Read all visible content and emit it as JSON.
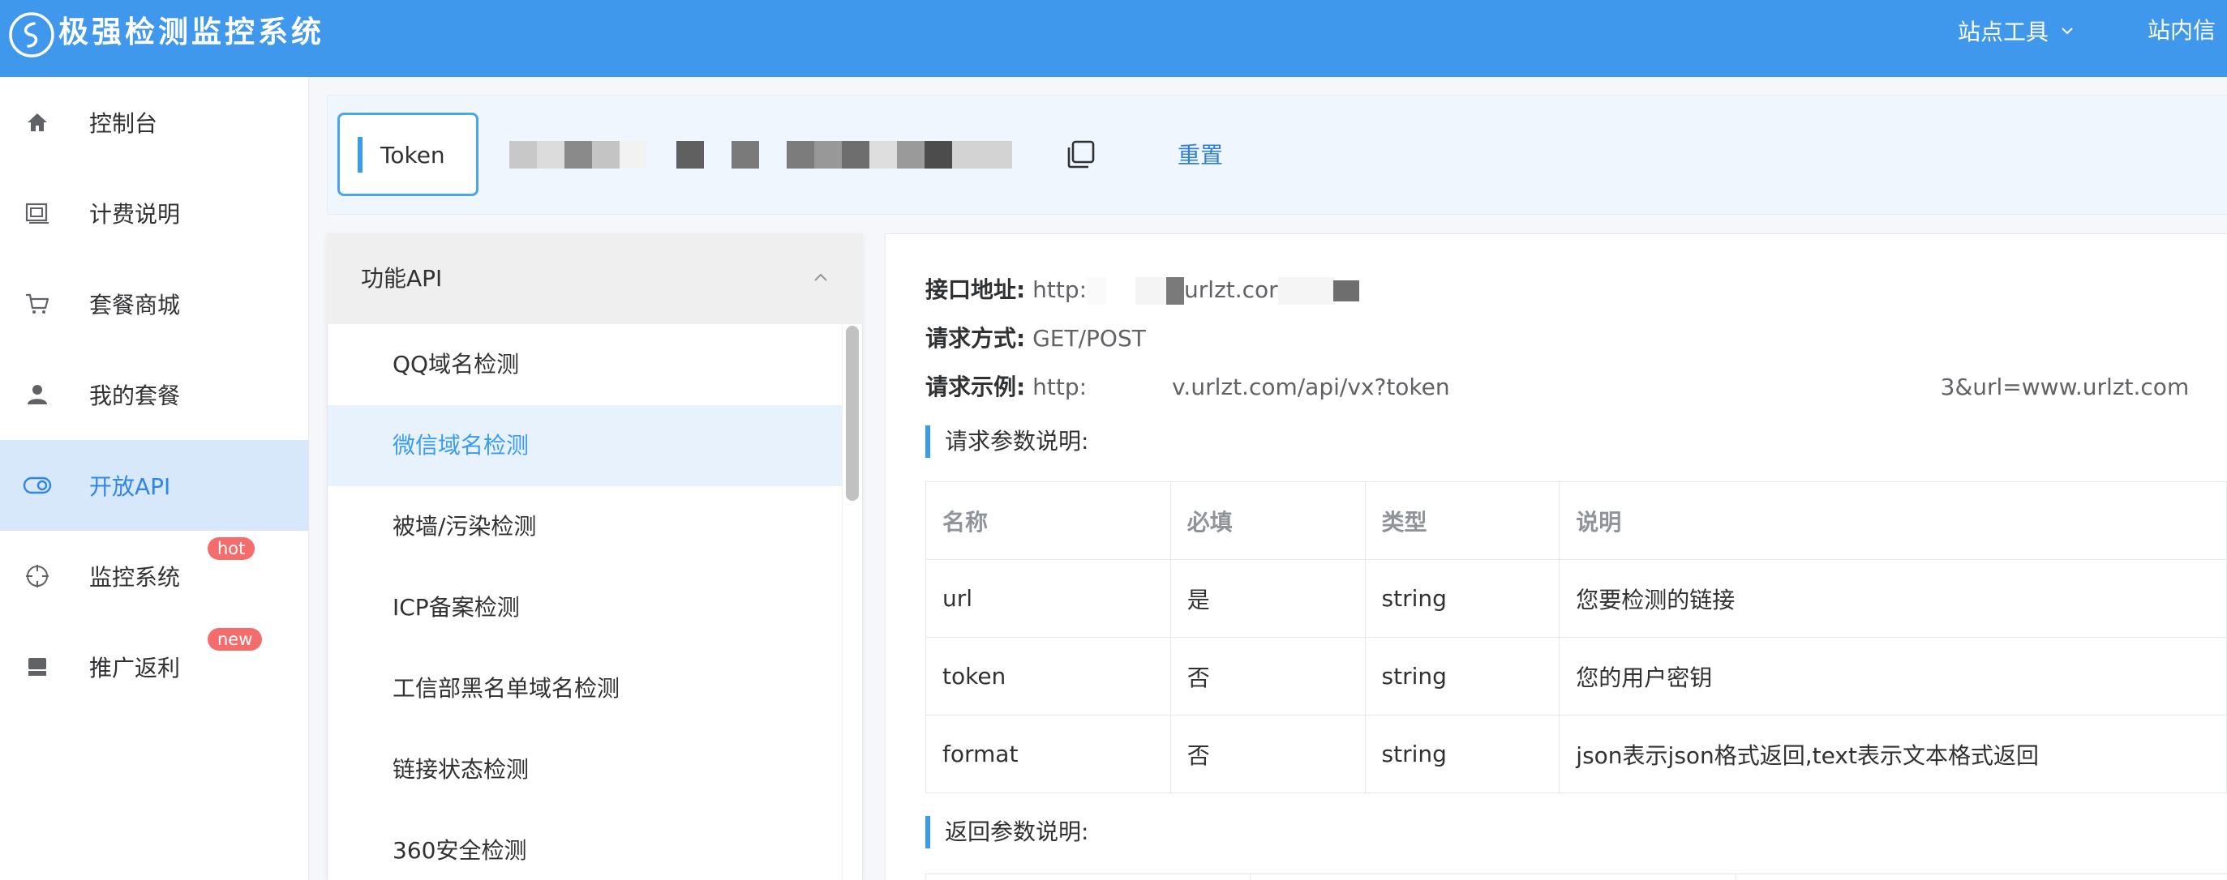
{
  "header": {
    "app_title": "极强检测监控系统",
    "site_tools_label": "站点工具",
    "site_messages_label": "站内信",
    "colors": {
      "bar": "#3f98ec",
      "text": "#ffffff"
    }
  },
  "sidebar": {
    "items": [
      {
        "label": "控制台",
        "icon": "home-icon",
        "active": false
      },
      {
        "label": "计费说明",
        "icon": "billing-icon",
        "active": false
      },
      {
        "label": "套餐商城",
        "icon": "cart-icon",
        "active": false
      },
      {
        "label": "我的套餐",
        "icon": "user-icon",
        "active": false
      },
      {
        "label": "开放API",
        "icon": "toggle-icon",
        "active": true
      },
      {
        "label": "监控系统",
        "icon": "crosshair-icon",
        "active": false,
        "badge": "hot"
      },
      {
        "label": "推广返利",
        "icon": "store-icon",
        "active": false,
        "badge": "new"
      }
    ],
    "active_color": "#2f86e6",
    "badge_color": "#f56c6c"
  },
  "token": {
    "tab_label": "Token",
    "reset_label": "重置"
  },
  "api_panel": {
    "title": "功能API",
    "items": [
      {
        "label": "QQ域名检测",
        "active": false
      },
      {
        "label": "微信域名检测",
        "active": true
      },
      {
        "label": "被墙/污染检测",
        "active": false
      },
      {
        "label": "ICP备案检测",
        "active": false
      },
      {
        "label": "工信部黑名单域名检测",
        "active": false
      },
      {
        "label": "链接状态检测",
        "active": false
      },
      {
        "label": "360安全检测",
        "active": false
      }
    ]
  },
  "doc": {
    "endpoint_label": "接口地址:",
    "endpoint_parts": [
      "http:",
      "urlzt.cor"
    ],
    "method_label": "请求方式:",
    "method_value": "GET/POST",
    "example_label": "请求示例:",
    "example_parts": [
      "http:",
      "v.urlzt.com/api/vx?token",
      "3&url=www.urlzt.com"
    ],
    "request_section": "请求参数说明:",
    "return_section": "返回参数说明:",
    "table": {
      "headers": [
        "名称",
        "必填",
        "类型",
        "说明"
      ],
      "rows": [
        [
          "url",
          "是",
          "string",
          "您要检测的链接"
        ],
        [
          "token",
          "否",
          "string",
          "您的用户密钥"
        ],
        [
          "format",
          "否",
          "string",
          "json表示json格式返回,text表示文本格式返回"
        ]
      ]
    }
  }
}
